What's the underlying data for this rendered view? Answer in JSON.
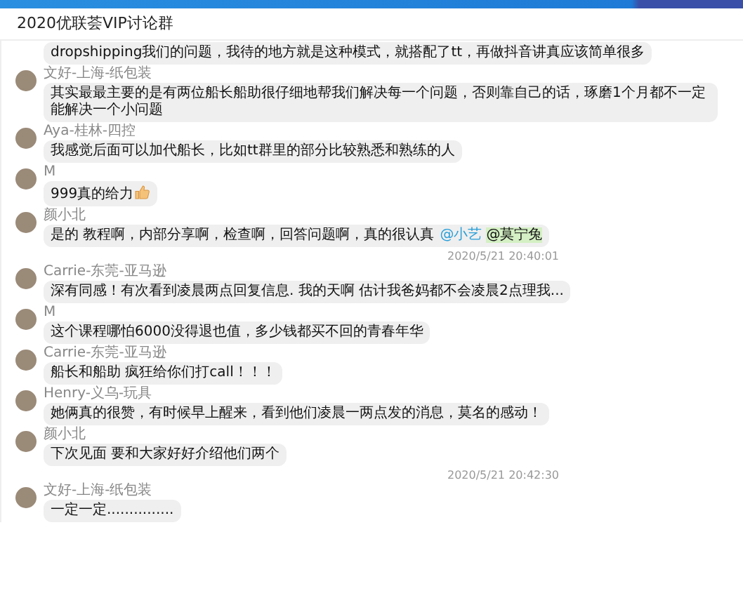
{
  "window": {
    "title": "2020优联荟VIP讨论群"
  },
  "items": [
    {
      "kind": "message",
      "segments": [
        {
          "kind": "text",
          "text": "dropshipping我们的问题，我待的地方就是这种模式，就搭配了tt，再做抖音讲真应该简单很多"
        }
      ]
    },
    {
      "kind": "message",
      "sender": "文好-上海-纸包装",
      "segments": [
        {
          "kind": "text",
          "text": "其实最最主要的是有两位船长船助很仔细地帮我们解决每一个问题，否则靠自己的话，琢磨1个月都不一定能解决一个小问题"
        }
      ]
    },
    {
      "kind": "message",
      "sender": "Aya-桂林-四控",
      "segments": [
        {
          "kind": "text",
          "text": "我感觉后面可以加代船长，比如tt群里的部分比较熟悉和熟练的人"
        }
      ]
    },
    {
      "kind": "message",
      "sender": "M",
      "segments": [
        {
          "kind": "text",
          "text": "999真的给力"
        },
        {
          "kind": "emoji"
        }
      ]
    },
    {
      "kind": "message",
      "sender": "颜小北",
      "segments": [
        {
          "kind": "text",
          "text": "是的 教程啊，内部分享啊，检查啊，回答问题啊，真的很认真"
        },
        {
          "kind": "mention",
          "text": "@小艺"
        },
        {
          "kind": "mention_highlight",
          "text": "@莫宁兔"
        }
      ]
    },
    {
      "kind": "timestamp",
      "text": "2020/5/21 20:40:01"
    },
    {
      "kind": "message",
      "sender": "Carrie-东莞-亚马逊",
      "segments": [
        {
          "kind": "text",
          "text": "深有同感！有次看到凌晨两点回复信息. 我的天啊 估计我爸妈都不会凌晨2点理我..."
        }
      ]
    },
    {
      "kind": "message",
      "sender": "M",
      "segments": [
        {
          "kind": "text",
          "text": "这个课程哪怕6000没得退也值，多少钱都买不回的青春年华"
        }
      ]
    },
    {
      "kind": "message",
      "sender": "Carrie-东莞-亚马逊",
      "segments": [
        {
          "kind": "text",
          "text": "船长和船助 疯狂给你们打call！！！"
        }
      ]
    },
    {
      "kind": "message",
      "sender": "Henry-义乌-玩具",
      "segments": [
        {
          "kind": "text",
          "text": "她俩真的很赞，有时候早上醒来，看到他们凌晨一两点发的消息，莫名的感动！"
        }
      ]
    },
    {
      "kind": "message",
      "sender": "颜小北",
      "segments": [
        {
          "kind": "text",
          "text": "下次见面 要和大家好好介绍他们两个"
        }
      ]
    },
    {
      "kind": "timestamp",
      "text": "2020/5/21 20:42:30"
    },
    {
      "kind": "message",
      "sender": "文好-上海-纸包装",
      "segments": [
        {
          "kind": "text",
          "text": "一定一定..............."
        }
      ]
    }
  ]
}
